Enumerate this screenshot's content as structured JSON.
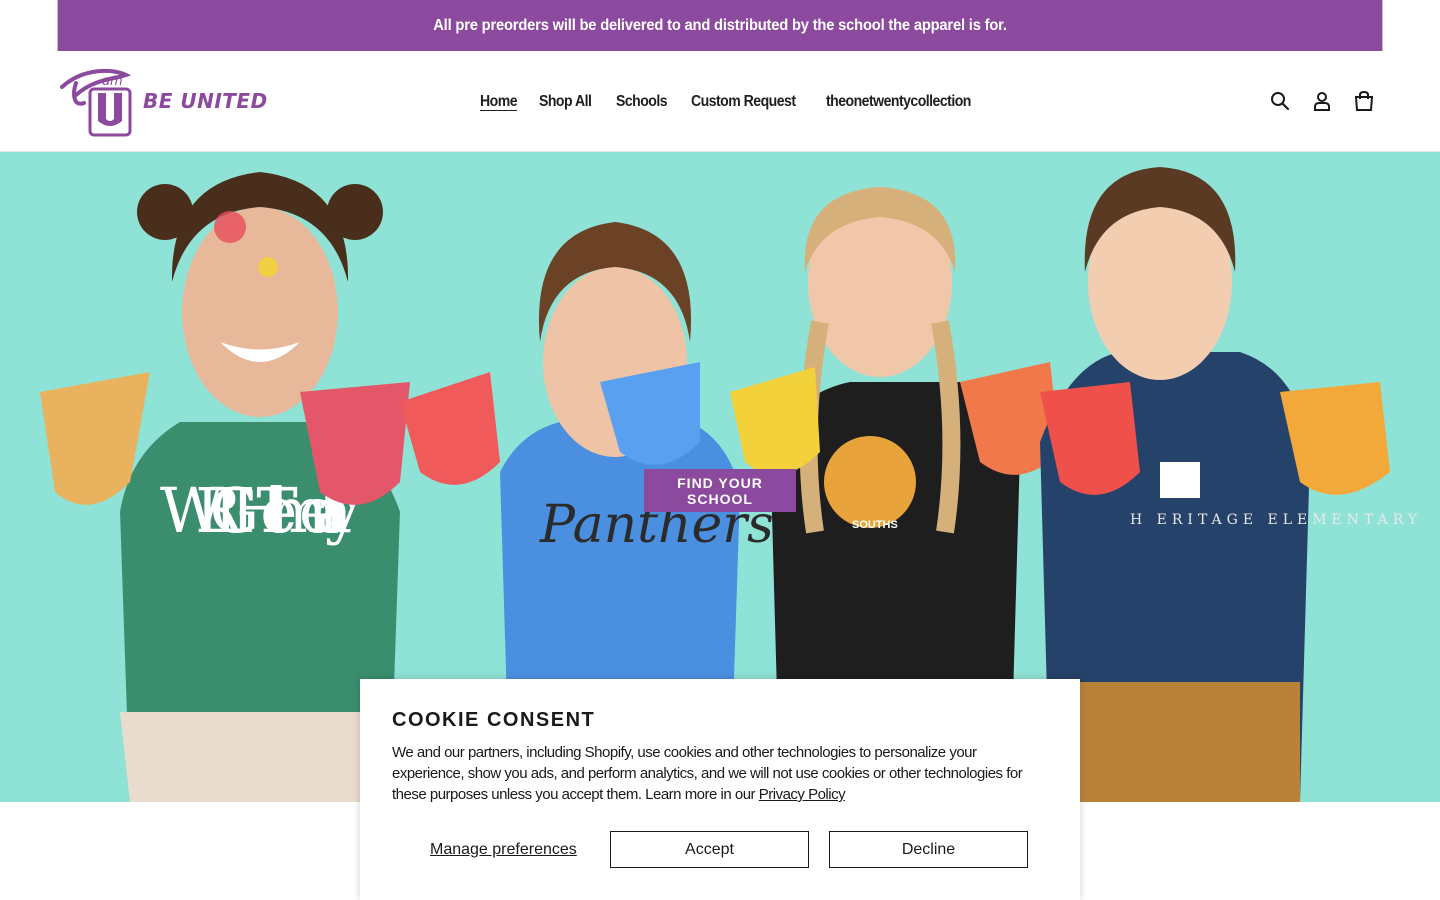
{
  "announcement": {
    "text": "All pre preorders will be delivered to and distributed by the school the apparel is for."
  },
  "brand": {
    "tagline": "BE UNITED",
    "color": "#8c4a9e"
  },
  "nav": {
    "items": [
      {
        "label": "Home",
        "active": true
      },
      {
        "label": "Shop All"
      },
      {
        "label": "Schools"
      },
      {
        "label": "Custom Request"
      },
      {
        "label": "theonetwentycollection"
      }
    ]
  },
  "header_icons": [
    "search-icon",
    "account-icon",
    "cart-icon"
  ],
  "hero": {
    "background": "#8fe3d6",
    "cta_label": "FIND YOUR SCHOOL",
    "shirts": [
      "WRIGHT elementary",
      "Panthers",
      "SOUTHS",
      "H ERITAGE ELEMENTARY"
    ]
  },
  "cookie": {
    "title": "COOKIE CONSENT",
    "body": "We and our partners, including Shopify, use cookies and other technologies to personalize your experience, show you ads, and perform analytics, and we will not use cookies or other technologies for these purposes unless you accept them. Learn more in our ",
    "link_text": "Privacy Policy",
    "manage_label": "Manage preferences",
    "accept_label": "Accept",
    "decline_label": "Decline"
  }
}
